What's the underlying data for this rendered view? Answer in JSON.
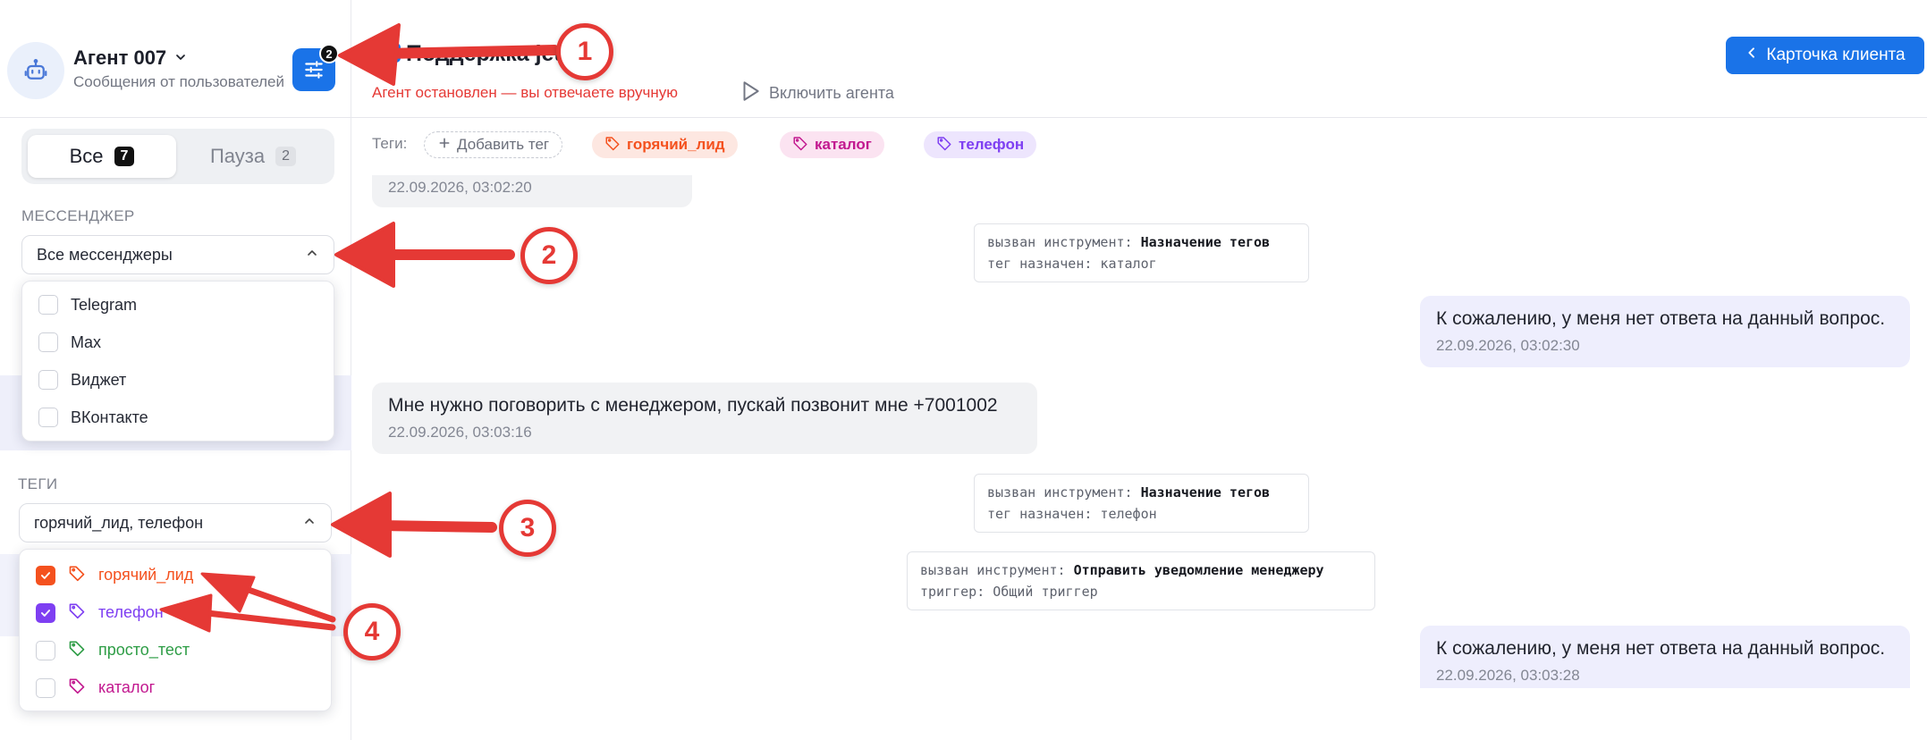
{
  "agent": {
    "name": "Агент 007",
    "subtitle": "Сообщения от пользователей",
    "filter_count": "2"
  },
  "segments": [
    {
      "label": "Все",
      "count": "7"
    },
    {
      "label": "Пауза",
      "count": "2"
    }
  ],
  "messenger": {
    "label": "МЕССЕНДЖЕР",
    "selected": "Все мессенджеры",
    "options": [
      "Telegram",
      "Max",
      "Виджет",
      "ВКонтакте"
    ]
  },
  "tags_filter": {
    "label": "ТЕГИ",
    "selected": "горячий_лид, телефон",
    "options": [
      {
        "label": "горячий_лид",
        "checked": true,
        "color": "#f4511e"
      },
      {
        "label": "телефон",
        "checked": true,
        "color": "#7e3ff2"
      },
      {
        "label": "просто_тест",
        "checked": false,
        "color": "#2e9d46"
      },
      {
        "label": "каталог",
        "checked": false,
        "color": "#c2188f"
      }
    ]
  },
  "chat": {
    "title": "Поддержка jet",
    "status": "Агент остановлен — вы отвечаете вручную",
    "enable_agent": "Включить агента",
    "client_card": "Карточка клиента",
    "tags_label": "Теги:",
    "add_tag": "Добавить тег",
    "tags": [
      {
        "label": "горячий_лид",
        "color": "#f4511e",
        "bg": "#fde7e1"
      },
      {
        "label": "каталог",
        "color": "#c2188f",
        "bg": "#fbe3f1"
      },
      {
        "label": "телефон",
        "color": "#7e3ff2",
        "bg": "#ede5fd"
      }
    ]
  },
  "messages": {
    "m0_time": "22.09.2026, 03:02:20",
    "t1_line1_key": "вызван инструмент:",
    "t1_line1_val": "Назначение тегов",
    "t1_line2": "тег назначен: каталог",
    "m1_text": "К сожалению, у меня нет ответа на данный вопрос.",
    "m1_time": "22.09.2026, 03:02:30",
    "m2_text": "Мне  нужно поговорить с менеджером, пускай позвонит мне +7001002",
    "m2_time": "22.09.2026, 03:03:16",
    "t2_line1_key": "вызван инструмент:",
    "t2_line1_val": "Назначение тегов",
    "t2_line2": "тег назначен: телефон",
    "t3_line1_key": "вызван инструмент:",
    "t3_line1_val": "Отправить уведомление менеджеру",
    "t3_line2": "триггер: Общий триггер",
    "m3_text": "К сожалению, у меня нет ответа на данный вопрос.",
    "m3_time": "22.09.2026, 03:03:28"
  },
  "annotations": [
    "1",
    "2",
    "3",
    "4"
  ],
  "colors": {
    "accent": "#1a73e8",
    "annotation": "#e53935",
    "status_stopped": "#e53935"
  }
}
